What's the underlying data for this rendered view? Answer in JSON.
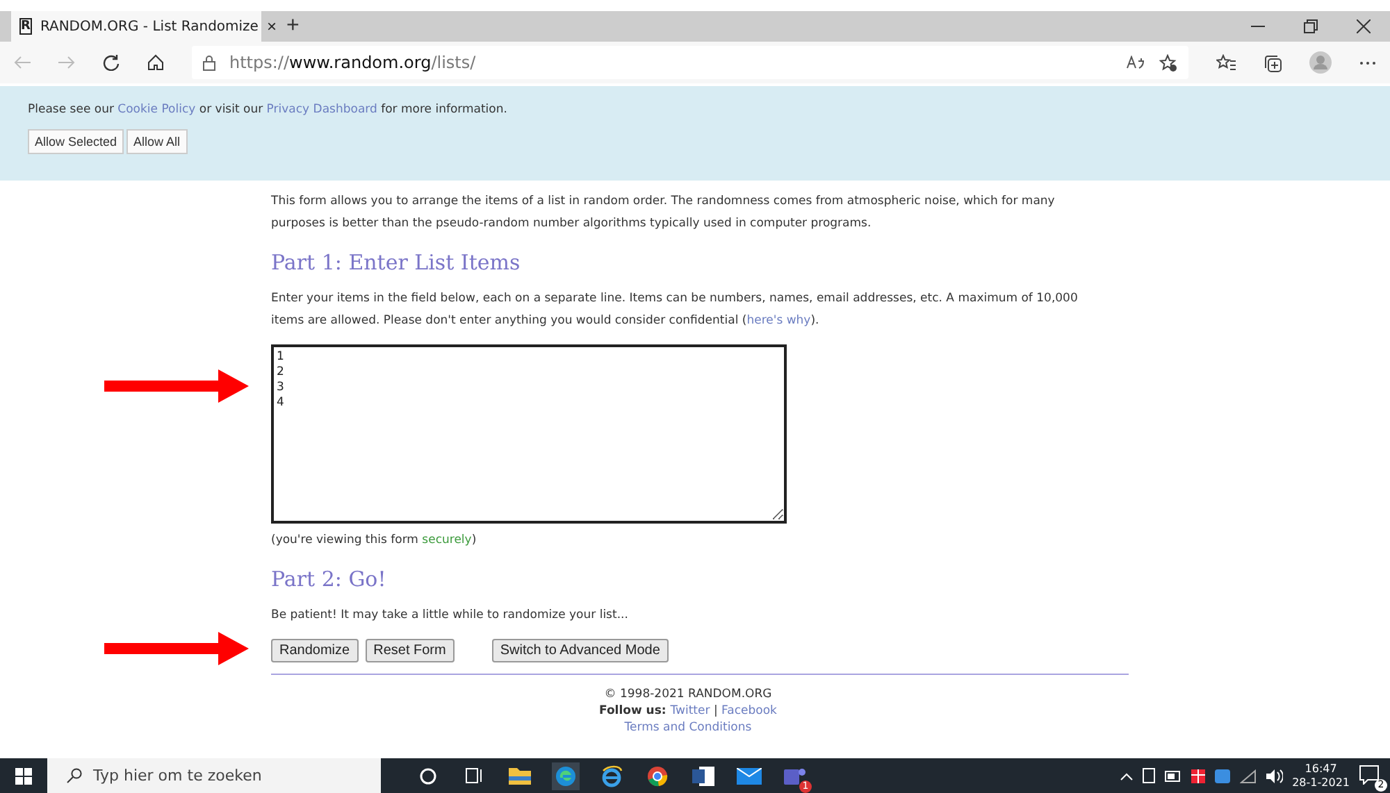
{
  "browser": {
    "tab": {
      "favicon": "R",
      "title": "RANDOM.ORG - List Randomize",
      "close": "×",
      "selected": true
    },
    "new_tab": "+",
    "address": {
      "scheme": "https://",
      "host": "www.random.org",
      "path": "/lists/"
    }
  },
  "cookie_banner": {
    "notice": [
      {
        "kind": "text",
        "text": "Please see our "
      },
      {
        "kind": "link",
        "text": "Cookie Policy"
      },
      {
        "kind": "text",
        "text": " or visit our "
      },
      {
        "kind": "link",
        "text": "Privacy Dashboard"
      },
      {
        "kind": "text",
        "text": " for more information."
      }
    ],
    "buttons": [
      "Allow Selected",
      "Allow All"
    ]
  },
  "intro": "This form allows you to arrange the items of a list in random order. The randomness comes from atmospheric noise, which for many purposes is better than the pseudo-random number algorithms typically used in computer programs.",
  "part1": {
    "heading": "Part 1: Enter List Items",
    "instructions": [
      {
        "kind": "text",
        "text": "Enter your items in the field below, each on a separate line. Items can be numbers, names, email addresses, etc. A maximum of 10,000 items are allowed. Please don't enter anything you would consider confidential ("
      },
      {
        "kind": "link",
        "text": "here's why"
      },
      {
        "kind": "text",
        "text": ")."
      }
    ],
    "items_value": "1\n2\n3\n4",
    "secure_note": [
      {
        "kind": "text",
        "text": "(you're viewing this form "
      },
      {
        "kind": "secure",
        "text": "securely"
      },
      {
        "kind": "text",
        "text": ")"
      }
    ]
  },
  "part2": {
    "heading": "Part 2: Go!",
    "note": "Be patient! It may take a little while to randomize your list...",
    "buttons": [
      "Randomize",
      "Reset Form"
    ],
    "advanced_button": "Switch to Advanced Mode"
  },
  "footer": {
    "copyright": "© 1998-2021 RANDOM.ORG",
    "follow": [
      {
        "kind": "label",
        "text": "Follow us: "
      },
      {
        "kind": "link",
        "text": "Twitter"
      },
      {
        "kind": "text",
        "text": " | "
      },
      {
        "kind": "link",
        "text": "Facebook"
      }
    ],
    "terms": "Terms and Conditions"
  },
  "taskbar": {
    "search_placeholder": "Typ hier om te zoeken",
    "teams_badge": "1",
    "time": "16:47",
    "date": "28-1-2021",
    "notifications": "2"
  }
}
